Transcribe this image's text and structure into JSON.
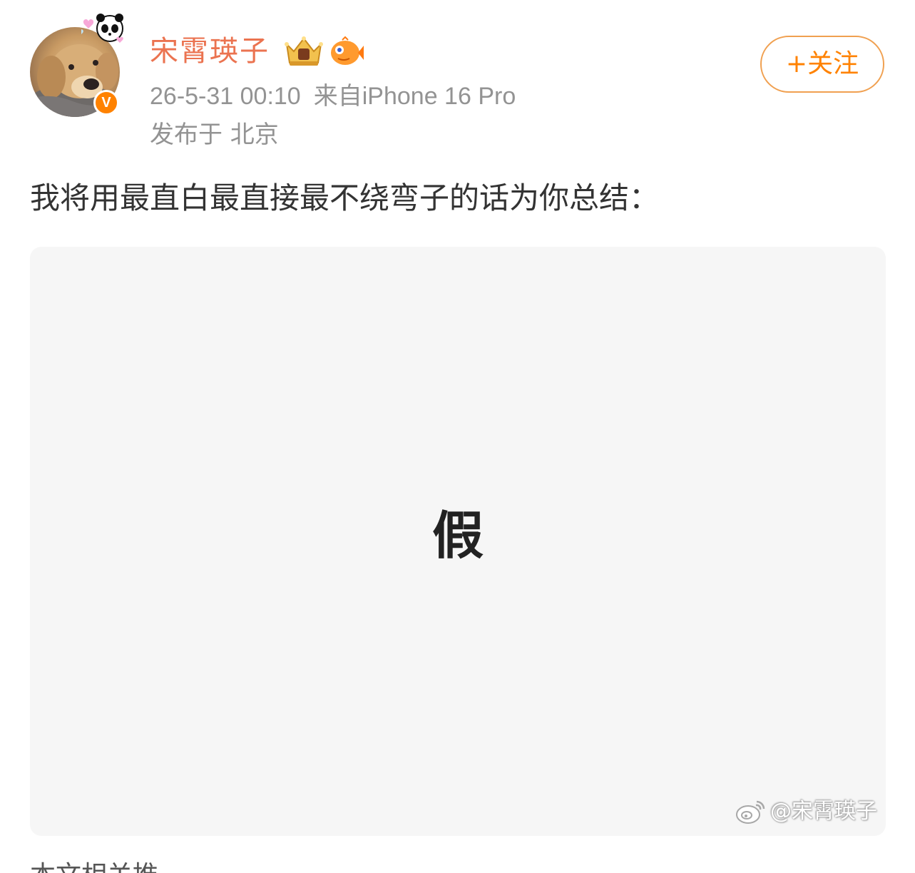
{
  "post": {
    "author": {
      "name": "宋霄瑛子",
      "verified_mark": "V",
      "avatar_icon": "dog-avatar",
      "badges": [
        "crown-member-icon",
        "pufferfish-icon"
      ]
    },
    "timestamp": "26-5-31 00:10",
    "source": "来自iPhone 16 Pro",
    "location": "发布于 北京",
    "follow_label": "+关注",
    "text": "我将用最直白最直接最不绕弯子的话为你总结：",
    "image": {
      "character": "假",
      "watermark": "@宋霄瑛子"
    },
    "next_text_fragment": "本文相关推"
  },
  "colors": {
    "accent": "#ff8200",
    "username": "#eb7350",
    "meta": "#939393",
    "body_text": "#333333",
    "image_bg": "#f6f6f6"
  }
}
